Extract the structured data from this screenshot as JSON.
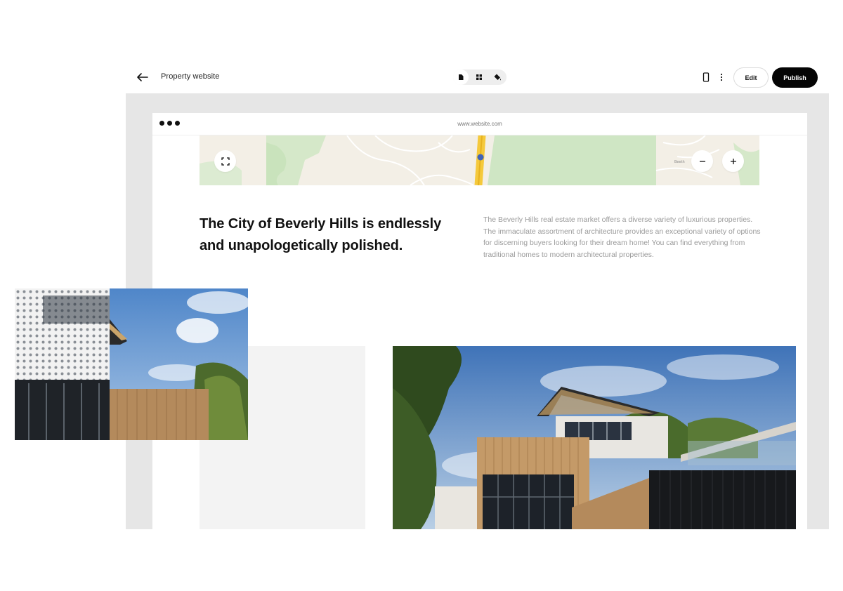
{
  "header": {
    "site_name": "Property website",
    "edit_label": "Edit",
    "publish_label": "Publish",
    "view_modes": [
      "page-icon",
      "grid-icon",
      "paint-bucket-icon"
    ],
    "active_view": 0
  },
  "browser": {
    "url": "www.website.com"
  },
  "content": {
    "headline": "The City of Beverly Hills is endlessly and unapologetically polished.",
    "body": "The Beverly Hills real estate market offers a diverse variety of luxurious properties. The immaculate assortment of architecture provides an exceptional variety of options for discerning buyers looking for their dream home! You can find everything from traditional homes to modern architectural properties."
  },
  "colors": {
    "accent": "#050505",
    "canvas": "#e6e6e6",
    "map_land": "#f3efe6",
    "map_green": "#cfe6c4",
    "map_road": "#f5c93b",
    "body_text": "#9a9a9a"
  }
}
